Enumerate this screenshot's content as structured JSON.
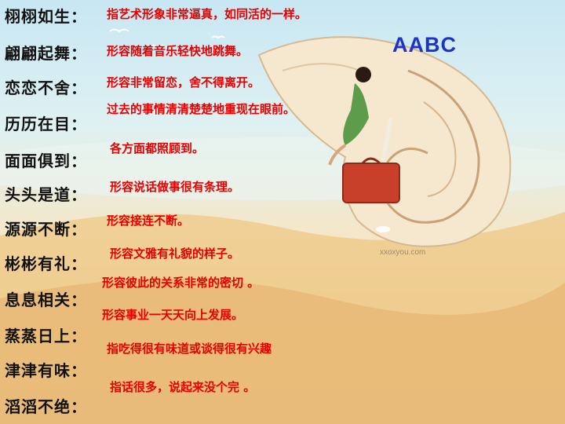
{
  "pattern_label": "AABC",
  "watermark": "xxoxyou.com",
  "idioms": [
    {
      "term": "栩栩如生：",
      "definition": "指艺术形象非常逼真，如同活的一样。"
    },
    {
      "term": "翩翩起舞：",
      "definition": "形容随着音乐轻快地跳舞。"
    },
    {
      "term": "恋恋不舍：",
      "definition": "形容非常留恋，舍不得离开。"
    },
    {
      "term": "历历在目：",
      "definition": "过去的事情清清楚楚地重现在眼前。"
    },
    {
      "term": "面面俱到：",
      "definition": "各方面都照顾到。"
    },
    {
      "term": "头头是道：",
      "definition": "形容说话做事很有条理。"
    },
    {
      "term": "源源不断：",
      "definition": "形容接连不断。"
    },
    {
      "term": "彬彬有礼：",
      "definition": "形容文雅有礼貌的样子。"
    },
    {
      "term": "息息相关：",
      "definition": "形容彼此的关系非常的密切 。"
    },
    {
      "term": "蒸蒸日上：",
      "definition": "形容事业一天天向上发展。"
    },
    {
      "term": "津津有味：",
      "definition": "指吃得很有味道或谈得很有兴趣"
    },
    {
      "term": "滔滔不绝：",
      "definition": "指话很多，说起来没个完 。"
    }
  ]
}
